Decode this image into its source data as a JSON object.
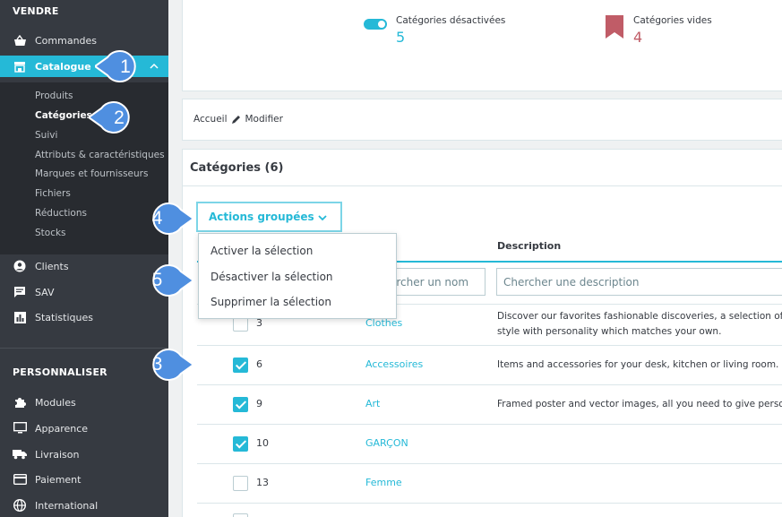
{
  "sidebar": {
    "section_sell": "VENDRE",
    "commandes": "Commandes",
    "catalogue": "Catalogue",
    "sub_items": [
      "Produits",
      "Catégories",
      "Suivi",
      "Attributs & caractéristiques",
      "Marques et fournisseurs",
      "Fichiers",
      "Réductions",
      "Stocks"
    ],
    "clients": "Clients",
    "sav": "SAV",
    "statistiques": "Statistiques",
    "section_custom": "PERSONNALISER",
    "modules": "Modules",
    "apparence": "Apparence",
    "livraison": "Livraison",
    "paiement": "Paiement",
    "international": "International"
  },
  "kpis": {
    "disabled_label": "Catégories désactivées",
    "disabled_value": "5",
    "empty_label": "Catégories vides",
    "empty_value": "4"
  },
  "breadcrumb": {
    "home": "Accueil",
    "edit": "Modifier"
  },
  "panel": {
    "title": "Catégories (6)"
  },
  "bulk": {
    "label": "Actions groupées",
    "menu": [
      "Activer la sélection",
      "Désactiver la sélection",
      "Supprimer la sélection"
    ]
  },
  "table": {
    "col_description": "Description",
    "filter_name_placeholder": "Chercher un nom",
    "filter_desc_placeholder": "Chercher une description",
    "rows": [
      {
        "id": "3",
        "name": "Clothes",
        "desc1": "Discover our favorites fashionable discoveries, a selection of",
        "desc2": "style with personality which matches your own.",
        "checked": false
      },
      {
        "id": "6",
        "name": "Accessoires",
        "desc1": "Items and accessories for your desk, kitchen or living room. C",
        "checked": true
      },
      {
        "id": "9",
        "name": "Art",
        "desc1": "Framed poster and vector images, all you need to give perso",
        "checked": true
      },
      {
        "id": "10",
        "name": "GARÇON",
        "desc1": "",
        "checked": true
      },
      {
        "id": "13",
        "name": "Femme",
        "desc1": "",
        "checked": false
      }
    ]
  },
  "callouts": [
    "1",
    "2",
    "3",
    "4",
    "5"
  ],
  "colors": {
    "accent": "#25b9d7",
    "sidebar": "#363a41",
    "callout": "#4f8fe0",
    "danger": "#c05c67"
  }
}
